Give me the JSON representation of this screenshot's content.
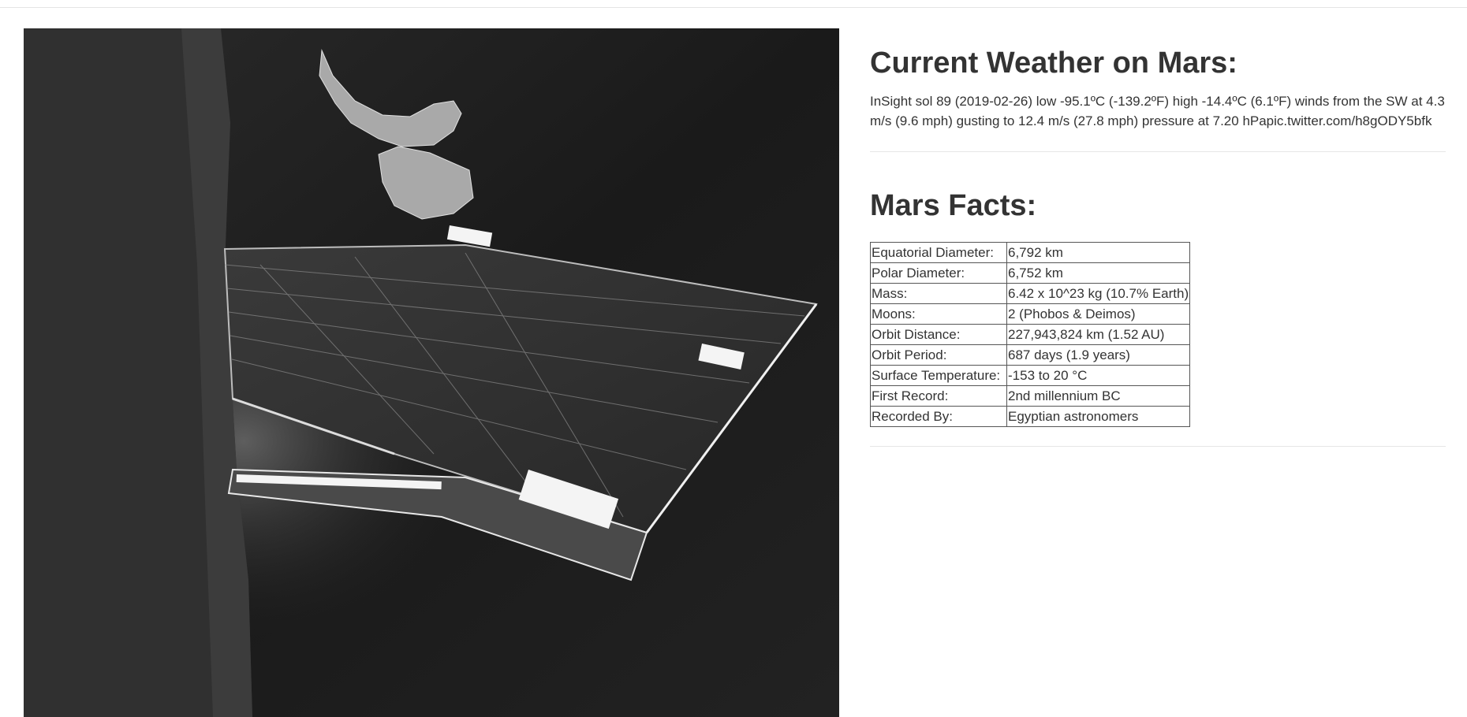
{
  "image": {
    "alt": ""
  },
  "weather": {
    "heading": "Current Weather on Mars:",
    "text": "InSight sol 89 (2019-02-26) low -95.1ºC (-139.2ºF) high -14.4ºC (6.1ºF) winds from the SW at 4.3 m/s (9.6 mph) gusting to 12.4 m/s (27.8 mph) pressure at 7.20 hPapic.twitter.com/h8gODY5bfk"
  },
  "facts": {
    "heading": "Mars Facts:",
    "rows": [
      {
        "label": "Equatorial Diameter:",
        "value": "6,792 km"
      },
      {
        "label": "Polar Diameter:",
        "value": "6,752 km"
      },
      {
        "label": "Mass:",
        "value": "6.42 x 10^23 kg (10.7% Earth)"
      },
      {
        "label": "Moons:",
        "value": "2 (Phobos & Deimos)"
      },
      {
        "label": "Orbit Distance:",
        "value": "227,943,824 km (1.52 AU)"
      },
      {
        "label": "Orbit Period:",
        "value": "687 days (1.9 years)"
      },
      {
        "label": "Surface Temperature:",
        "value": "-153 to 20 °C"
      },
      {
        "label": "First Record:",
        "value": "2nd millennium BC"
      },
      {
        "label": "Recorded By:",
        "value": "Egyptian astronomers"
      }
    ]
  }
}
